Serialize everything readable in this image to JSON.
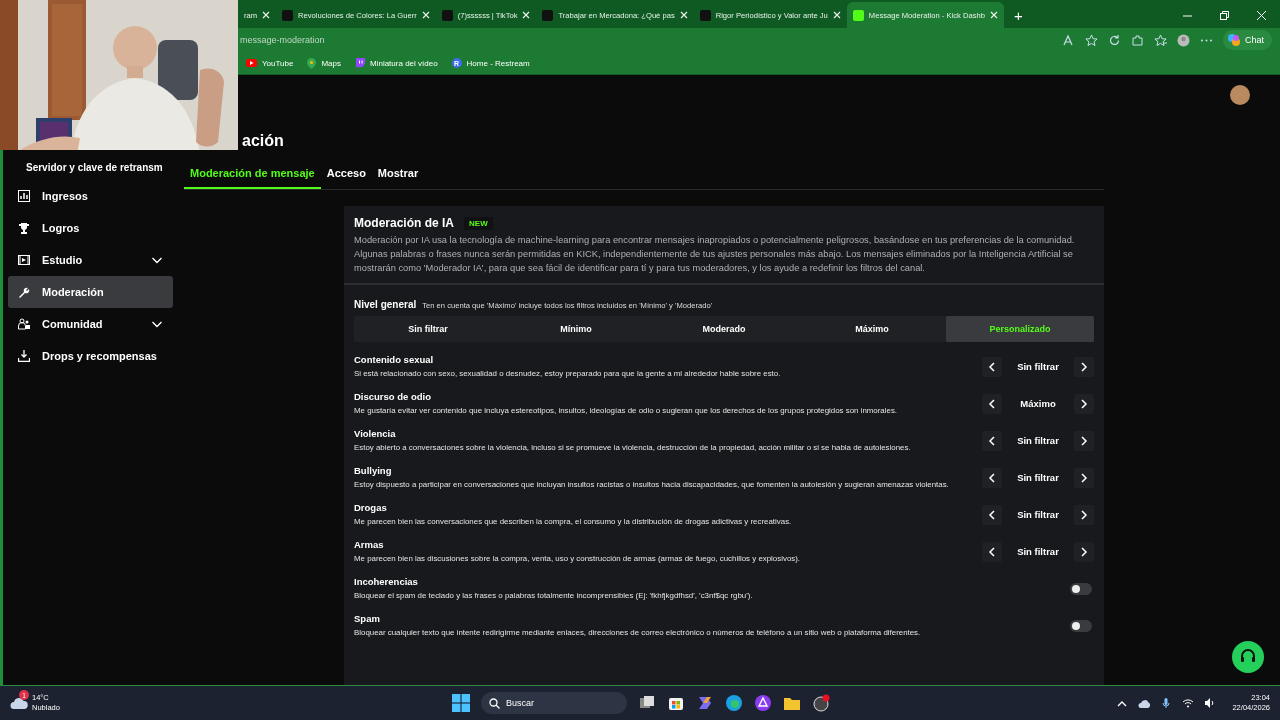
{
  "browser": {
    "tabs": [
      {
        "title": "ram",
        "selected": false
      },
      {
        "title": "Revoluciones de Colores: La Guerr",
        "selected": false
      },
      {
        "title": "(7)ssssss | TikTok",
        "selected": false
      },
      {
        "title": "Trabajar en Mercadona: ¿Qué pas",
        "selected": false
      },
      {
        "title": "Rigor Periodístico y Valor ante Ju",
        "selected": false
      },
      {
        "title": "Message Moderation - Kick Dashb",
        "selected": true
      }
    ],
    "new_tab": "+",
    "address": "message-moderation",
    "chat_button": "Chat",
    "bookmarks": [
      {
        "label": "YouTube"
      },
      {
        "label": "Maps"
      },
      {
        "label": "Miniatura del vídeo"
      },
      {
        "label": "Home - Restream",
        "letter": "R"
      }
    ]
  },
  "sidebar": {
    "items": [
      {
        "label": "Servidor y clave de retransm",
        "expandable": false,
        "selected": false
      },
      {
        "label": "Ingresos",
        "expandable": false,
        "selected": false
      },
      {
        "label": "Logros",
        "expandable": false,
        "selected": false
      },
      {
        "label": "Estudio",
        "expandable": true,
        "selected": false
      },
      {
        "label": "Moderación",
        "expandable": false,
        "selected": true
      },
      {
        "label": "Comunidad",
        "expandable": true,
        "selected": false
      },
      {
        "label": "Drops y recompensas",
        "expandable": false,
        "selected": false
      }
    ]
  },
  "page": {
    "heading": "ación",
    "tabs": [
      {
        "label": "Moderación de mensaje",
        "selected": true
      },
      {
        "label": "Acceso",
        "selected": false
      },
      {
        "label": "Mostrar",
        "selected": false
      }
    ],
    "card": {
      "title": "Moderación de IA",
      "badge": "NEW",
      "description": "Moderación por IA usa la tecnología de machine-learning para encontrar mensajes inapropiados o potencialmente peligrosos, basándose en tus preferencias de la comunidad. Algunas palabras o frases nunca serán permitidas en KICK, independientemente de tus ajustes personales más abajo. Los mensajes eliminados por la Inteligencia Artificial se mostrarán como 'Moderador IA', para que sea fácil de identificar para tí y para tus moderadores, y los ayude a redefinir los filtros del canal.",
      "level_label": "Nivel general",
      "level_note": "Ten en cuenta que 'Máximo' incluye todos los filtros incluidos en 'Mínimo' y 'Moderado'",
      "levels": [
        {
          "label": "Sin filtrar",
          "selected": false
        },
        {
          "label": "Mínimo",
          "selected": false
        },
        {
          "label": "Moderado",
          "selected": false
        },
        {
          "label": "Máximo",
          "selected": false
        },
        {
          "label": "Personalizado",
          "selected": true
        }
      ],
      "rules": [
        {
          "kind": "stepper",
          "title": "Contenido sexual",
          "description": "Si está relacionado con sexo, sexualidad o desnudez, estoy preparado para que la gente a mi alrededor hable sobre esto.",
          "value": "Sin filtrar"
        },
        {
          "kind": "stepper",
          "title": "Discurso de odio",
          "description": "Me gustaría evitar ver contenido que incluya estereotipos, insultos, ideologías de odio o sugieran que los derechos de los grupos protegidos son inmorales.",
          "value": "Máximo"
        },
        {
          "kind": "stepper",
          "title": "Violencia",
          "description": "Estoy abierto a conversaciones sobre la violencia, incluso si se promueve la violencia, destrucción de la propiedad, acción militar o si se habla de autolesiones.",
          "value": "Sin filtrar"
        },
        {
          "kind": "stepper",
          "title": "Bullying",
          "description": "Estoy dispuesto a participar en conversaciones que incluyan insultos racistas o insultos hacia discapacidades, que fomenten la autolesión y sugieran amenazas violentas.",
          "value": "Sin filtrar"
        },
        {
          "kind": "stepper",
          "title": "Drogas",
          "description": "Me parecen bien las conversaciones que describen la compra, el consumo y la distribución de drogas adictivas y recreativas.",
          "value": "Sin filtrar"
        },
        {
          "kind": "stepper",
          "title": "Armas",
          "description": "Me parecen bien las discusiones sobre la compra, venta, uso y construcción de armas (armas de fuego, cuchillos y explosivos).",
          "value": "Sin filtrar"
        },
        {
          "kind": "toggle",
          "title": "Incoherencias",
          "description": "Bloquear el spam de teclado y las frases o palabras totalmente incomprensibles (Ej: 'fkhfjkgdfhsd', 'c3nf$qc rgbu').",
          "on": false
        },
        {
          "kind": "toggle",
          "title": "Spam",
          "description": "Bloquear cualquier texto que intente redirigirme mediante enlaces, direcciones de correo electrónico o números de teléfono a un sitio web o plataforma diferentes.",
          "on": false
        }
      ]
    }
  },
  "taskbar": {
    "weather": {
      "temp": "14°C",
      "condition": "Nublado",
      "badge": "1"
    },
    "search": "Buscar",
    "time": "23:04",
    "date": "22/04/2026"
  }
}
